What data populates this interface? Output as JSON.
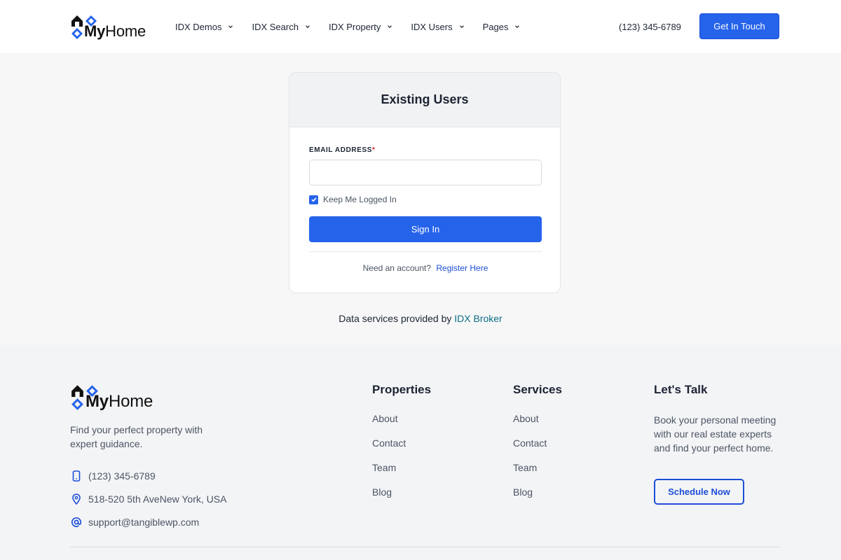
{
  "header": {
    "logo_prefix": "My",
    "logo_suffix": "Home",
    "nav": [
      {
        "label": "IDX Demos"
      },
      {
        "label": "IDX Search"
      },
      {
        "label": "IDX Property"
      },
      {
        "label": "IDX Users"
      },
      {
        "label": "Pages"
      }
    ],
    "phone": "(123) 345-6789",
    "cta_label": "Get In Touch"
  },
  "login": {
    "title": "Existing Users",
    "email_label": "EMAIL ADDRESS",
    "required_mark": "*",
    "email_value": "",
    "keep_logged_in_label": "Keep Me Logged In",
    "keep_logged_in_checked": true,
    "signin_label": "Sign In",
    "need_account_text": "Need an account?",
    "register_label": "Register Here"
  },
  "data_services": {
    "text": "Data services provided by",
    "link": "IDX Broker"
  },
  "footer": {
    "logo_prefix": "My",
    "logo_suffix": "Home",
    "tagline": "Find your perfect property with expert guidance.",
    "contact": {
      "phone": "(123) 345-6789",
      "address": "518-520 5th AveNew York, USA",
      "email": "support@tangiblewp.com"
    },
    "properties": {
      "title": "Properties",
      "links": [
        "About",
        "Contact",
        "Team",
        "Blog"
      ]
    },
    "services": {
      "title": "Services",
      "links": [
        "About",
        "Contact",
        "Team",
        "Blog"
      ]
    },
    "talk": {
      "title": "Let's Talk",
      "text": "Book your personal meeting with our real estate experts and find your perfect home.",
      "button_label": "Schedule Now"
    }
  },
  "colors": {
    "accent": "#2563eb",
    "link_teal": "#0b6e86",
    "required": "#dc2626"
  }
}
